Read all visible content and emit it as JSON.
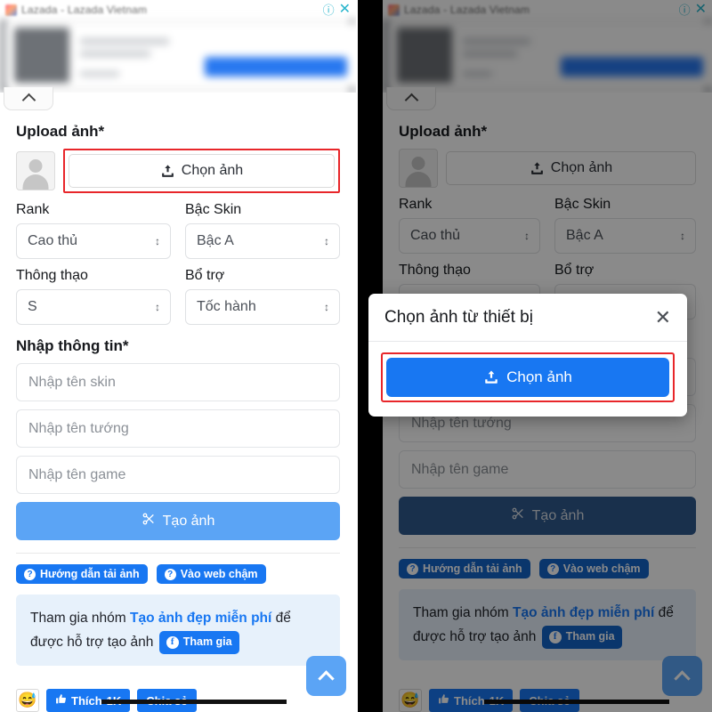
{
  "ad": {
    "brand_text": "Lazada - Lazada Vietnam",
    "info_icon": "info-circle-icon",
    "close_icon": "close-icon"
  },
  "form": {
    "upload_label": "Upload ảnh*",
    "choose_image_label": "Chọn ảnh",
    "upload_icon": "upload-icon",
    "avatar_icon": "avatar-placeholder-icon",
    "fields": {
      "rank_label": "Rank",
      "rank_value": "Cao thủ",
      "skin_tier_label": "Bậc Skin",
      "skin_tier_value": "Bậc A",
      "mastery_label": "Thông thạo",
      "mastery_value": "S",
      "support_label": "Bổ trợ",
      "support_value": "Tốc hành"
    },
    "info_section_label": "Nhập thông tin*",
    "inputs": [
      {
        "name": "skin-name",
        "placeholder": "Nhập tên skin",
        "value": ""
      },
      {
        "name": "champion-name",
        "placeholder": "Nhập tên tướng",
        "value": ""
      },
      {
        "name": "game-name",
        "placeholder": "Nhập tên game",
        "value": ""
      }
    ],
    "submit_label": "Tạo ảnh",
    "submit_icon": "scissors-icon"
  },
  "badges": [
    {
      "icon": "question-mark-icon",
      "label": "Hướng dẫn tải ảnh"
    },
    {
      "icon": "question-mark-icon",
      "label": "Vào web chậm"
    }
  ],
  "notice": {
    "prefix": "Tham gia nhóm ",
    "group_name": "Tạo ảnh đẹp miễn phí",
    "middle": " để được hỗ trợ tạo ảnh ",
    "join_label": "Tham gia",
    "facebook_icon": "facebook-icon"
  },
  "fb_bar": {
    "emoji": "😅",
    "like_label": "Thích",
    "like_count": "1K",
    "share_label": "Chia sẻ",
    "thumbs_icon": "thumbs-up-icon"
  },
  "scroll_top": {
    "icon": "chevron-up-icon"
  },
  "collapse_tab": {
    "icon": "chevron-up-icon"
  },
  "modal": {
    "title": "Chọn ảnh từ thiết bị",
    "close_icon": "close-icon",
    "choose_label": "Chọn ảnh",
    "upload_icon": "upload-icon"
  },
  "colors": {
    "facebook_blue": "#1877f2",
    "light_blue": "#5ba4f5",
    "highlight_red": "#e8262a",
    "notice_bg": "#e7f1fb",
    "info_icon_teal": "#27b5cc",
    "dim_overlay": "rgba(0,0,0,0.46)"
  }
}
